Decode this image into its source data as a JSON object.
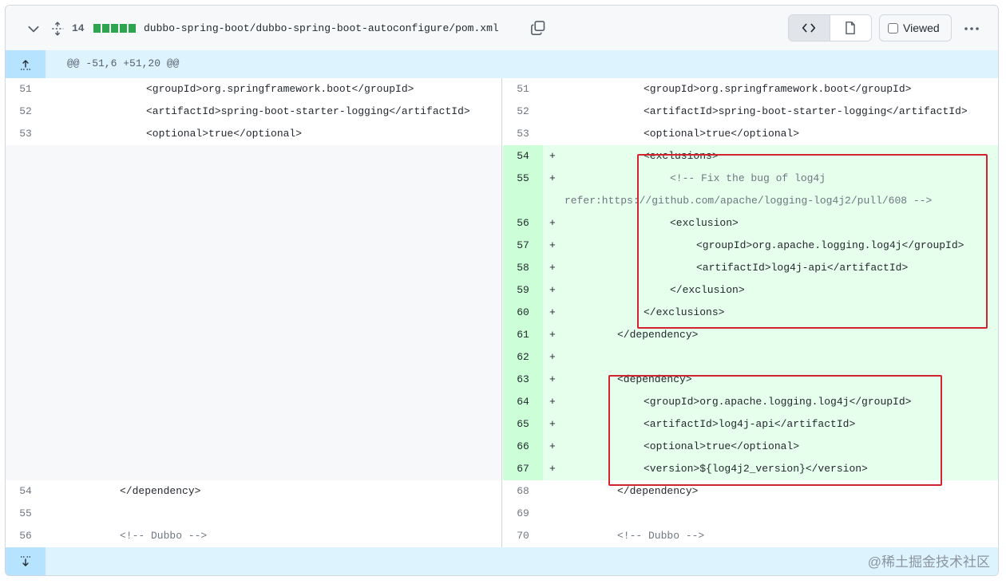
{
  "file_header": {
    "changed_lines": "14",
    "diff_bar_count": 5,
    "path": "dubbo-spring-boot/dubbo-spring-boot-autoconfigure/pom.xml",
    "viewed_label": "Viewed",
    "icons": [
      "chevron-down-icon",
      "unfold-icon",
      "copy-icon",
      "code-icon",
      "file-icon",
      "kebab-horizontal-icon"
    ],
    "addition_color": "#2da44e"
  },
  "hunk_top": {
    "header": "@@ -51,6 +51,20 @@"
  },
  "left": {
    "lines": [
      {
        "num": "51",
        "text": "<groupId>org.springframework.boot</groupId>"
      },
      {
        "num": "52",
        "text": "<artifactId>spring-boot-starter-logging</artifactId>"
      },
      {
        "num": "53",
        "text": "<optional>true</optional>"
      },
      {
        "num": "54",
        "text": "</dependency>"
      },
      {
        "num": "55",
        "text": ""
      },
      {
        "num": "56",
        "text": "<!-- Dubbo -->"
      }
    ]
  },
  "right": {
    "lines": [
      {
        "num": "51",
        "marker": "",
        "text": "<groupId>org.springframework.boot</groupId>"
      },
      {
        "num": "52",
        "marker": "",
        "text": "<artifactId>spring-boot-starter-logging</artifactId>"
      },
      {
        "num": "53",
        "marker": "",
        "text": "<optional>true</optional>"
      },
      {
        "num": "54",
        "marker": "+",
        "text": "<exclusions>"
      },
      {
        "num": "55",
        "marker": "+",
        "text": "<!-- Fix the bug of log4j",
        "text_cont": "refer:https://github.com/apache/logging-log4j2/pull/608 -->"
      },
      {
        "num": "56",
        "marker": "+",
        "text": "<exclusion>"
      },
      {
        "num": "57",
        "marker": "+",
        "text": "<groupId>org.apache.logging.log4j</groupId>"
      },
      {
        "num": "58",
        "marker": "+",
        "text": "<artifactId>log4j-api</artifactId>"
      },
      {
        "num": "59",
        "marker": "+",
        "text": "</exclusion>"
      },
      {
        "num": "60",
        "marker": "+",
        "text": "</exclusions>"
      },
      {
        "num": "61",
        "marker": "+",
        "text": "</dependency>"
      },
      {
        "num": "62",
        "marker": "+",
        "text": ""
      },
      {
        "num": "63",
        "marker": "+",
        "text": "<dependency>"
      },
      {
        "num": "64",
        "marker": "+",
        "text": "<groupId>org.apache.logging.log4j</groupId>"
      },
      {
        "num": "65",
        "marker": "+",
        "text": "<artifactId>log4j-api</artifactId>"
      },
      {
        "num": "66",
        "marker": "+",
        "text": "<optional>true</optional>"
      },
      {
        "num": "67",
        "marker": "+",
        "text": "<version>${log4j2_version}</version>"
      },
      {
        "num": "68",
        "marker": "",
        "text": "</dependency>"
      },
      {
        "num": "69",
        "marker": "",
        "text": ""
      },
      {
        "num": "70",
        "marker": "",
        "text": "<!-- Dubbo -->"
      }
    ]
  },
  "watermark": "@稀土掘金技术社区",
  "colors": {
    "addition_bg": "#e6ffec",
    "addition_num_bg": "#ccffd8",
    "hunk_bg": "#ddf4ff",
    "highlight_box": "#d1242f"
  }
}
